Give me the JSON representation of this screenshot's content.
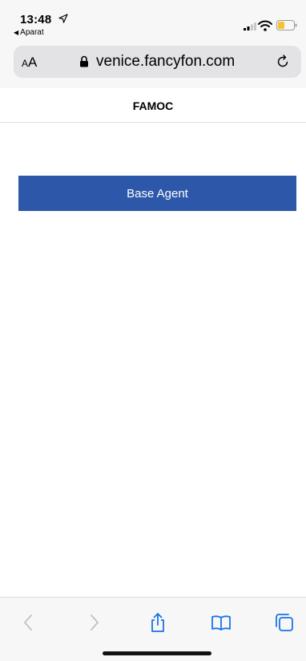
{
  "status_bar": {
    "time": "13:48",
    "back_app_label": "Aparat",
    "icons": [
      "location-arrow-icon",
      "signal-icon",
      "wifi-icon",
      "battery-icon"
    ],
    "battery_color": "#f4c430"
  },
  "address_bar": {
    "text_size_label": "AA",
    "url": "venice.fancyfon.com",
    "icons": [
      "lock-icon",
      "reload-icon"
    ]
  },
  "page": {
    "title": "FAMOC",
    "button_label": "Base Agent",
    "button_color": "#2d58a9"
  },
  "toolbar": {
    "icons": [
      "back-icon",
      "forward-icon",
      "share-icon",
      "bookmarks-icon",
      "tabs-icon"
    ],
    "accent_color": "#1a73e8"
  }
}
